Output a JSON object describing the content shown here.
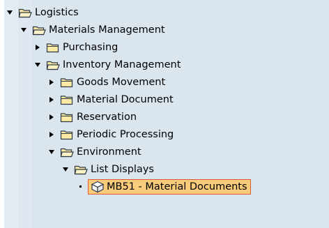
{
  "tree": {
    "logistics": {
      "label": "Logistics"
    },
    "materials_management": {
      "label": "Materials Management"
    },
    "purchasing": {
      "label": "Purchasing"
    },
    "inventory_management": {
      "label": "Inventory Management"
    },
    "goods_movement": {
      "label": "Goods Movement"
    },
    "material_document": {
      "label": "Material Document"
    },
    "reservation": {
      "label": "Reservation"
    },
    "periodic_processing": {
      "label": "Periodic Processing"
    },
    "environment": {
      "label": "Environment"
    },
    "list_displays": {
      "label": "List Displays"
    },
    "mb51": {
      "label": "MB51 - Material Documents"
    }
  },
  "icons": {
    "expanded": "triangle-down-icon",
    "collapsed": "triangle-right-icon",
    "open_folder": "open-folder-icon",
    "closed_folder": "closed-folder-icon",
    "transaction": "transaction-cube-icon"
  },
  "colors": {
    "level_band": "#e4ecf3",
    "folder_fill": "#fbe9a4",
    "folder_stroke": "#2d3a47",
    "selected_fill": "#fbcb7c",
    "selected_border": "#d85a36"
  }
}
